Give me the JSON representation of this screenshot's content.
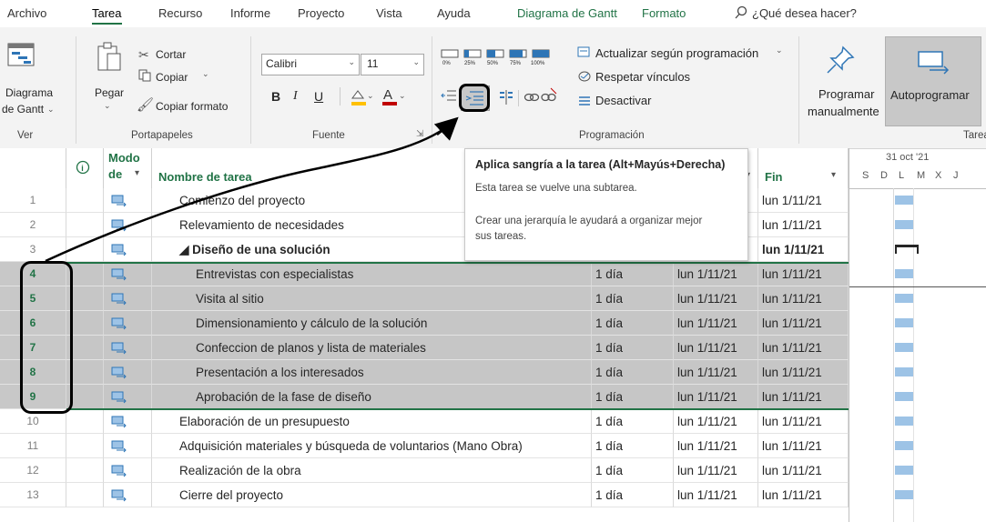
{
  "menu": {
    "tabs": [
      "Archivo",
      "Tarea",
      "Recurso",
      "Informe",
      "Proyecto",
      "Vista",
      "Ayuda"
    ],
    "contextual_tab": "Diagrama de Gantt",
    "format_tab": "Formato",
    "tell_me": "¿Qué desea hacer?"
  },
  "ribbon": {
    "ver": {
      "button_line1": "Diagrama",
      "button_line2": "de Gantt",
      "label": "Ver"
    },
    "portapapeles": {
      "paste": "Pegar",
      "cut": "Cortar",
      "copy": "Copiar",
      "copy_format": "Copiar formato",
      "label": "Portapapeles"
    },
    "fuente": {
      "font": "Calibri",
      "size": "11",
      "bold": "B",
      "italic": "I",
      "underline": "U",
      "label": "Fuente"
    },
    "programacion": {
      "pct": [
        "0%",
        "25%",
        "50%",
        "75%",
        "100%"
      ],
      "update": "Actualizar según programación",
      "respect": "Respetar vínculos",
      "deactivate": "Desactivar",
      "label": "Programación"
    },
    "tareas": {
      "manual_line1": "Programar",
      "manual_line2": "manualmente",
      "auto": "Autoprogramar",
      "label": "Tarea"
    }
  },
  "tooltip": {
    "title": "Aplica sangría a la tarea (Alt+Mayús+Derecha)",
    "line1": "Esta tarea se vuelve una subtarea.",
    "line2": "Crear una jerarquía le ayudará a organizar mejor",
    "line3": "sus tareas."
  },
  "grid": {
    "headers": {
      "mode_line1": "Modo",
      "mode_line2": "de",
      "name": "Nombre de tarea",
      "end": "Fin"
    },
    "rows": [
      {
        "id": "1",
        "name": "Comienzo del proyecto",
        "dur": "",
        "start": "",
        "end": "lun 1/11/21"
      },
      {
        "id": "2",
        "name": "Relevamiento de necesidades",
        "dur": "",
        "start": "",
        "end": "lun 1/11/21"
      },
      {
        "id": "3",
        "name": "◢ Diseño de una solución",
        "dur": "",
        "start": "",
        "end": "lun 1/11/21"
      },
      {
        "id": "4",
        "name": "Entrevistas con especialistas",
        "dur": "1 día",
        "start": "lun 1/11/21",
        "end": "lun 1/11/21"
      },
      {
        "id": "5",
        "name": "Visita al sitio",
        "dur": "1 día",
        "start": "lun 1/11/21",
        "end": "lun 1/11/21"
      },
      {
        "id": "6",
        "name": "Dimensionamiento y cálculo de la solución",
        "dur": "1 día",
        "start": "lun 1/11/21",
        "end": "lun 1/11/21"
      },
      {
        "id": "7",
        "name": "Confeccion de planos y lista de materiales",
        "dur": "1 día",
        "start": "lun 1/11/21",
        "end": "lun 1/11/21"
      },
      {
        "id": "8",
        "name": "Presentación a los interesados",
        "dur": "1 día",
        "start": "lun 1/11/21",
        "end": "lun 1/11/21"
      },
      {
        "id": "9",
        "name": "Aprobación de la fase de diseño",
        "dur": "1 día",
        "start": "lun 1/11/21",
        "end": "lun 1/11/21"
      },
      {
        "id": "10",
        "name": "Elaboración de un presupuesto",
        "dur": "1 día",
        "start": "lun 1/11/21",
        "end": "lun 1/11/21"
      },
      {
        "id": "11",
        "name": "Adquisición materiales y búsqueda de voluntarios (Mano Obra)",
        "dur": "1 día",
        "start": "lun 1/11/21",
        "end": "lun 1/11/21"
      },
      {
        "id": "12",
        "name": "Realización de la obra",
        "dur": "1 día",
        "start": "lun 1/11/21",
        "end": "lun 1/11/21"
      },
      {
        "id": "13",
        "name": "Cierre del proyecto",
        "dur": "1 día",
        "start": "lun 1/11/21",
        "end": "lun 1/11/21"
      }
    ]
  },
  "timeline": {
    "week": "31 oct '21",
    "days": [
      "S",
      "D",
      "L",
      "M",
      "X",
      "J"
    ]
  },
  "colors": {
    "accent": "#217346",
    "selected_row": "#c6c6c6",
    "gantt_bar": "#9dc3e6",
    "summary": "#262626"
  }
}
